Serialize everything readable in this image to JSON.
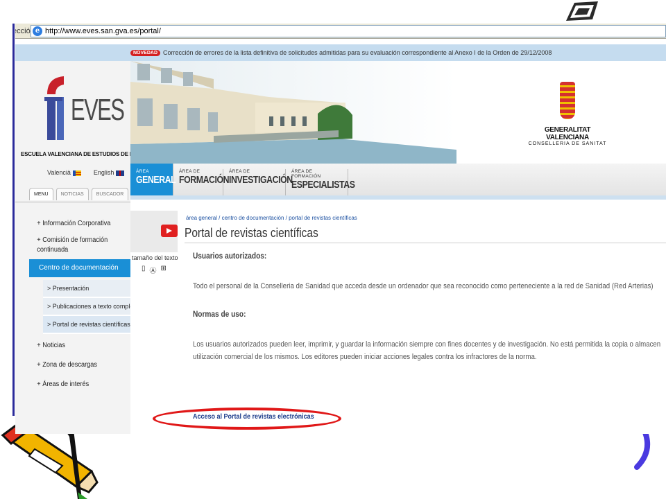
{
  "browser": {
    "address_label": "Dirección",
    "url": "http://www.eves.san.gva.es/portal/"
  },
  "news": {
    "badge": "NOVEDAD",
    "text": "Corrección de errores de la lista definitiva de solicitudes admitidas para su evaluación correspondiente al Anexo I de la Orden de 29/12/2008"
  },
  "logo": {
    "text": "EVES",
    "school": "ESCUELA VALENCIANA DE ESTUDIOS DE LA SALUD"
  },
  "languages": [
    "Valencià",
    "English"
  ],
  "tabs": [
    "MENU",
    "NOTICIAS",
    "BUSCADOR"
  ],
  "menu": {
    "items_top": [
      "+ Información Corporativa",
      "+ Comisión de formación",
      "continuada"
    ],
    "active": "Centro de documentación",
    "subitems": [
      "> Presentación",
      "> Publicaciones a texto completo",
      "> Portal de revistas científicas"
    ],
    "items_bottom": [
      "+ Noticias",
      "+ Zona de descargas",
      "+ Áreas de interés"
    ]
  },
  "gva": {
    "name": "GENERALITAT VALENCIANA",
    "dept": "CONSELLERIA DE SANITAT"
  },
  "areas": [
    {
      "small": "ÁREA",
      "big": "GENERAL"
    },
    {
      "small": "ÁREA DE",
      "big": "FORMACIÓN"
    },
    {
      "small": "ÁREA DE",
      "big": "INVESTIGACIÓN"
    },
    {
      "small": "ÁREA DE FORMACIÓN",
      "big": "ESPECIALISTAS"
    }
  ],
  "content": {
    "text_size_label": "tamaño del texto",
    "breadcrumb": "área general / centro de documentación / portal de revistas científicas",
    "title": "Portal de revistas científicas",
    "h1": "Usuarios autorizados:",
    "p1": "Todo el personal de la Conselleria de Sanidad que acceda desde un ordenador que sea reconocido como perteneciente a la red  de Sanidad (Red Arterias)",
    "h2": "Normas de uso:",
    "p2a": "Los usuarios autorizados pueden leer, imprimir, y guardar la información siempre con fines docentes y de investigación. No está permitida la copia o almacen",
    "p2b": "utilización comercial de los mismos. Los editores pueden iniciar acciones legales contra los infractores de la norma.",
    "access_link": "Acceso al  Portal de revistas electrónicas"
  },
  "colors": {
    "accent_blue": "#1a8fd6",
    "highlight_red": "#e01818",
    "news_bar": "#c5dcef"
  }
}
